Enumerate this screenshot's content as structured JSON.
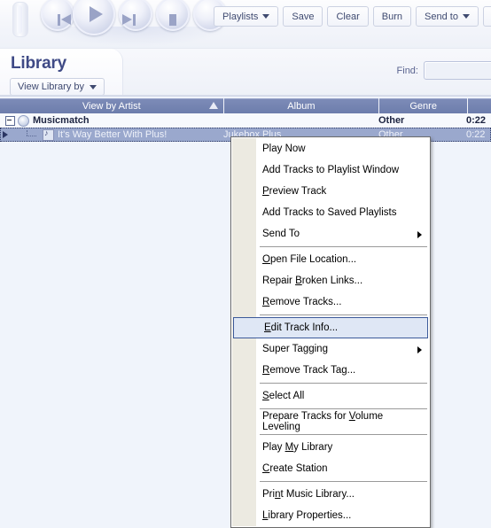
{
  "toolbar": {
    "transport": [
      {
        "name": "previous-track-button",
        "icon": "previous-icon"
      },
      {
        "name": "play-button",
        "icon": "play-icon"
      },
      {
        "name": "next-track-button",
        "icon": "next-icon"
      },
      {
        "name": "pause-button",
        "icon": "pause-icon"
      },
      {
        "name": "stop-button",
        "icon": "stop-icon"
      }
    ],
    "buttons": [
      {
        "label": "Playlists",
        "caret": true
      },
      {
        "label": "Save",
        "caret": false
      },
      {
        "label": "Clear",
        "caret": false
      },
      {
        "label": "Burn",
        "caret": false
      },
      {
        "label": "Send to",
        "caret": true
      }
    ]
  },
  "tabstrip": {
    "tab_label": "Library",
    "view_by_label": "View Library by",
    "find_label": "Find:",
    "find_value": "",
    "find_placeholder": ""
  },
  "table": {
    "columns": [
      "View by Artist",
      "Album",
      "Genre",
      ""
    ],
    "sort_column": "View by Artist",
    "sort_direction": "ascending",
    "rows": [
      {
        "type": "group",
        "artist": "Musicmatch",
        "album": "",
        "genre": "Other",
        "time": "0:22",
        "selected": false
      },
      {
        "type": "track",
        "artist": "It's Way Better With Plus!",
        "album": "Jukebox Plus",
        "genre": "Other",
        "time": "0:22",
        "selected": true
      }
    ]
  },
  "context_menu": {
    "items": [
      {
        "type": "item",
        "label": "Play Now",
        "accel": "",
        "submenu": false,
        "selected": false
      },
      {
        "type": "item",
        "label": "Add Tracks to Playlist Window",
        "accel": "",
        "submenu": false,
        "selected": false
      },
      {
        "type": "item",
        "label": "Preview Track",
        "accel": "P",
        "submenu": false,
        "selected": false
      },
      {
        "type": "item",
        "label": "Add Tracks to Saved Playlists",
        "accel": "",
        "submenu": false,
        "selected": false
      },
      {
        "type": "item",
        "label": "Send To",
        "accel": "",
        "submenu": true,
        "selected": false
      },
      {
        "type": "separator"
      },
      {
        "type": "item",
        "label": "Open File Location...",
        "accel": "O",
        "submenu": false,
        "selected": false
      },
      {
        "type": "item",
        "label": "Repair Broken Links...",
        "accel": "B",
        "submenu": false,
        "selected": false
      },
      {
        "type": "item",
        "label": "Remove Tracks...",
        "accel": "R",
        "submenu": false,
        "selected": false
      },
      {
        "type": "separator"
      },
      {
        "type": "item",
        "label": "Edit Track Info...",
        "accel": "E",
        "submenu": false,
        "selected": true
      },
      {
        "type": "item",
        "label": "Super Tagging",
        "accel": "",
        "submenu": true,
        "selected": false
      },
      {
        "type": "item",
        "label": "Remove Track Tag...",
        "accel": "R",
        "submenu": false,
        "selected": false
      },
      {
        "type": "separator"
      },
      {
        "type": "item",
        "label": "Select All",
        "accel": "S",
        "submenu": false,
        "selected": false
      },
      {
        "type": "separator"
      },
      {
        "type": "item",
        "label": "Prepare Tracks for Volume Leveling",
        "accel": "V",
        "submenu": false,
        "selected": false
      },
      {
        "type": "separator"
      },
      {
        "type": "item",
        "label": "Play My Library",
        "accel": "M",
        "submenu": false,
        "selected": false
      },
      {
        "type": "item",
        "label": "Create Station",
        "accel": "C",
        "submenu": false,
        "selected": false
      },
      {
        "type": "separator"
      },
      {
        "type": "item",
        "label": "Print Music Library...",
        "accel": "n",
        "submenu": false,
        "selected": false
      },
      {
        "type": "item",
        "label": "Library Properties...",
        "accel": "L",
        "submenu": false,
        "selected": false
      }
    ]
  },
  "colors": {
    "header_blue": "#6d7dac",
    "selection_blue": "#9aa8cd",
    "menu_highlight": "#dfe7f5",
    "menu_highlight_border": "#3c5a9a",
    "tab_title": "#3f4a86",
    "page_background": "#f0f4fb"
  }
}
